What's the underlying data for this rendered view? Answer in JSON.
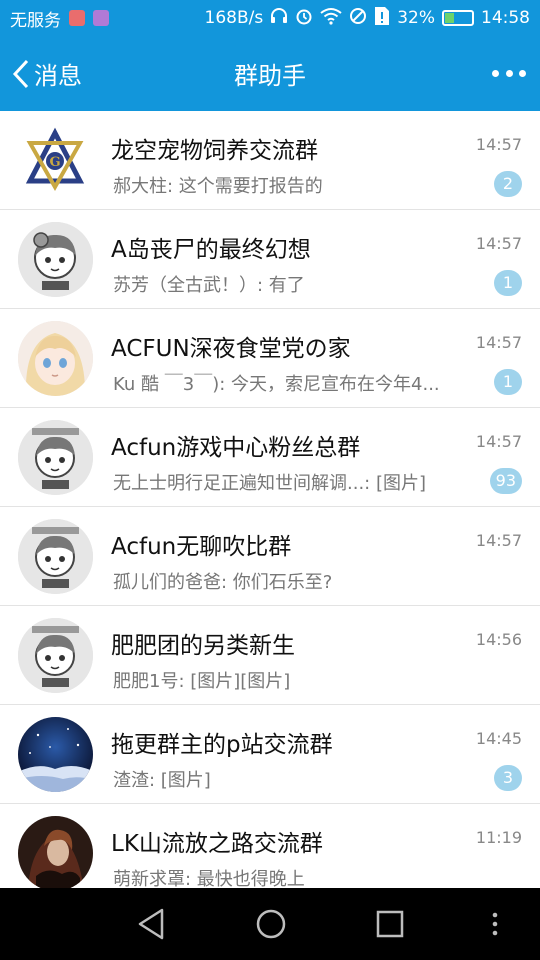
{
  "status_bar": {
    "carrier": "无服务",
    "speed": "168B/s",
    "battery_percent": "32%",
    "time": "14:58"
  },
  "nav": {
    "back_label": "消息",
    "title": "群助手"
  },
  "colors": {
    "accent": "#1296db",
    "badge": "#9fd3ec"
  },
  "conversations": [
    {
      "title": "龙空宠物饲养交流群",
      "time": "14:57",
      "message": "郝大柱: 这个需要打报告的",
      "badge": "2",
      "avatar_icon": "compass-emblem-icon"
    },
    {
      "title": "A岛丧尸的最终幻想",
      "time": "14:57",
      "message": "苏芳（全古武！）: 有了",
      "badge": "1",
      "avatar_icon": "anime-girl-avatar"
    },
    {
      "title": "ACFUN深夜食堂党の家",
      "time": "14:57",
      "message": "Ku 酷 ￣3￣): 今天，索尼宣布在今年4...",
      "badge": "1",
      "avatar_icon": "blonde-girl-avatar"
    },
    {
      "title": "Acfun游戏中心粉丝总群",
      "time": "14:57",
      "message": "无上士明行足正遍知世间解调...: [图片]",
      "badge": "93",
      "avatar_icon": "anime-girl-avatar"
    },
    {
      "title": "Acfun无聊吹比群",
      "time": "14:57",
      "message": "孤儿们的爸爸: 你们石乐至?",
      "badge": "",
      "avatar_icon": "anime-girl-avatar"
    },
    {
      "title": "肥肥团的另类新生",
      "time": "14:56",
      "message": "肥肥1号: [图片][图片]",
      "badge": "",
      "avatar_icon": "anime-girl-avatar"
    },
    {
      "title": "拖更群主的p站交流群",
      "time": "14:45",
      "message": "渣渣: [图片]",
      "badge": "3",
      "avatar_icon": "night-sky-avatar"
    },
    {
      "title": "LK山流放之路交流群",
      "time": "11:19",
      "message": "萌新求罩: 最快也得晚上",
      "badge": "",
      "avatar_icon": "dark-figure-avatar"
    }
  ]
}
